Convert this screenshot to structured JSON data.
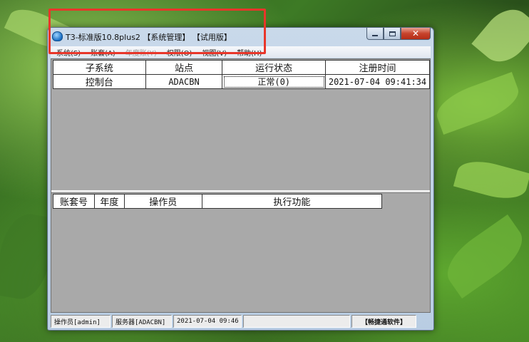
{
  "window": {
    "title": "T3-标准版10.8plus2 【系统管理】 【试用版】"
  },
  "menu": [
    {
      "label": "系统(S)",
      "enabled": true
    },
    {
      "label": "账套(A)",
      "enabled": true
    },
    {
      "label": "年度账(Y)",
      "enabled": false
    },
    {
      "label": "权限(O)",
      "enabled": true
    },
    {
      "label": "视图(V)",
      "enabled": true
    },
    {
      "label": "帮助(H)",
      "enabled": true
    }
  ],
  "upper_table": {
    "headers": [
      "子系统",
      "站点",
      "运行状态",
      "注册时间"
    ],
    "rows": [
      [
        "控制台",
        "ADACBN",
        "正常(0)",
        "2021-07-04 09:41:34"
      ]
    ]
  },
  "lower_table": {
    "headers": [
      "账套号",
      "年度",
      "操作员",
      "执行功能"
    ]
  },
  "status": {
    "operator": "操作员[admin]",
    "server": "服务器[ADACBN]",
    "datetime": "2021-07-04 09:46",
    "brand": "【畅捷通软件】"
  },
  "colors": {
    "highlight": "#e8362a",
    "client_bg": "#a9a9a9"
  }
}
